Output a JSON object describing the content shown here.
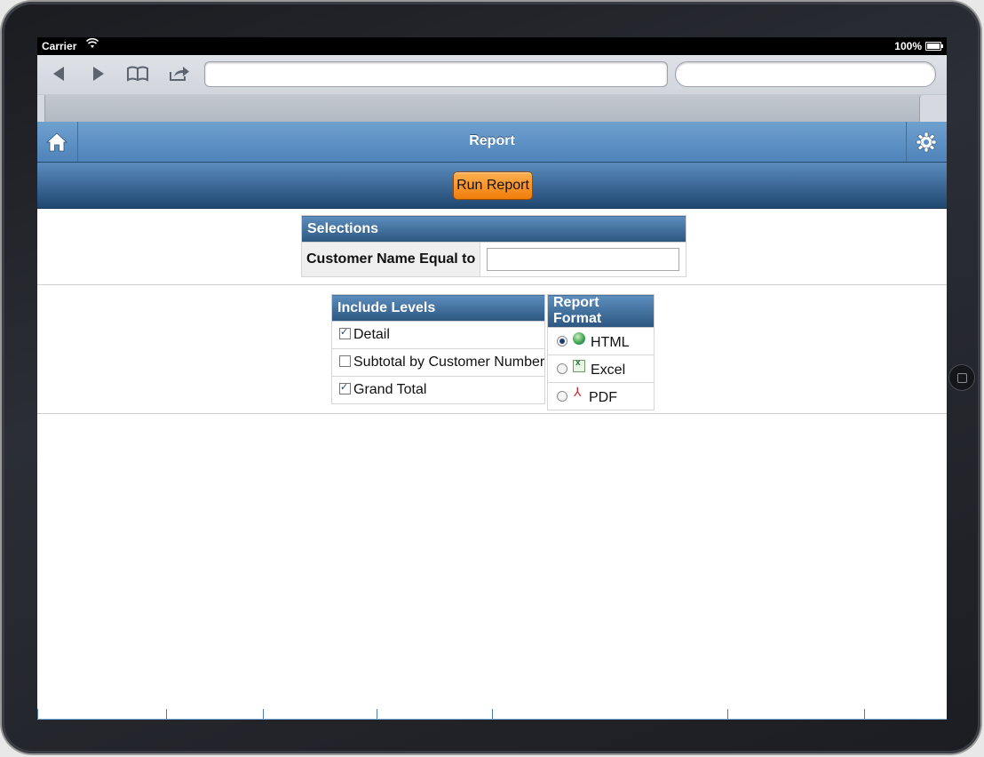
{
  "status_bar": {
    "carrier": "Carrier",
    "battery": "100%"
  },
  "header": {
    "title": "Report"
  },
  "toolbar": {
    "run_report_label": "Run Report"
  },
  "selections": {
    "title": "Selections",
    "customer_label": "Customer Name Equal to",
    "customer_value": ""
  },
  "include_levels": {
    "title": "Include Levels",
    "items": [
      {
        "label": "Detail",
        "checked": true
      },
      {
        "label": "Subtotal by Customer Number",
        "checked": false
      },
      {
        "label": "Grand Total",
        "checked": true
      }
    ]
  },
  "report_format": {
    "title": "Report Format",
    "options": [
      {
        "label": "HTML",
        "icon": "globe-icon",
        "selected": true
      },
      {
        "label": "Excel",
        "icon": "excel-icon",
        "selected": false
      },
      {
        "label": "PDF",
        "icon": "pdf-icon",
        "selected": false
      }
    ]
  },
  "colors": {
    "header_blue": "#5a8ec2",
    "toolbar_dark_blue": "#1f4770",
    "run_button_orange": "#f59320"
  }
}
